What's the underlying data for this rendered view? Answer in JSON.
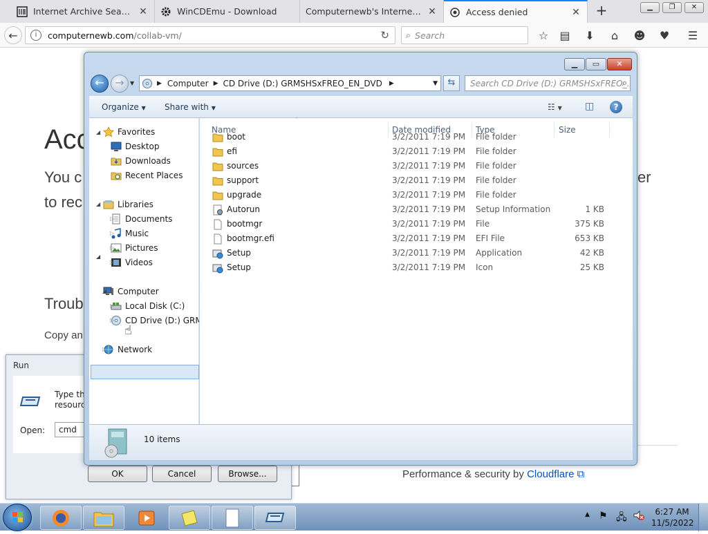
{
  "browser": {
    "tabs": [
      {
        "title": "Internet Archive Search: wi...",
        "icon": "archive-icon"
      },
      {
        "title": "WinCDEmu - Download",
        "icon": "gear-icon"
      },
      {
        "title": "Computernewb's Internet Pub ...",
        "icon": "none"
      },
      {
        "title": "Access denied",
        "icon": "cloudflare-icon"
      }
    ],
    "url_host": "computernewb.com",
    "url_path": "/collab-vm/",
    "search_placeholder": "Search"
  },
  "page": {
    "heading_partial": "Acc",
    "text_line1_partial": "You c",
    "text_line1_end": "er",
    "text_line2_partial": "to rec",
    "trouble_partial": "Troubl",
    "copy_partial": "Copy an",
    "footer_prefix": "Performance & security by",
    "footer_link": "Cloudflare"
  },
  "explorer": {
    "breadcrumb": [
      "Computer",
      "CD Drive (D:) GRMSHSxFREO_EN_DVD"
    ],
    "search_placeholder": "Search CD Drive (D:) GRMSHSxFREO_...",
    "toolbar": {
      "organize": "Organize",
      "share": "Share with"
    },
    "nav": {
      "favorites": "Favorites",
      "desktop": "Desktop",
      "downloads": "Downloads",
      "recent": "Recent Places",
      "libraries": "Libraries",
      "documents": "Documents",
      "music": "Music",
      "pictures": "Pictures",
      "videos": "Videos",
      "computer": "Computer",
      "local_disk": "Local Disk (C:)",
      "cd_drive": "CD Drive (D:) GRMSH",
      "network": "Network"
    },
    "columns": {
      "name": "Name",
      "date": "Date modified",
      "type": "Type",
      "size": "Size"
    },
    "files": [
      {
        "name": "boot",
        "date": "3/2/2011 7:19 PM",
        "type": "File folder",
        "size": "",
        "icon": "folder-icon"
      },
      {
        "name": "efi",
        "date": "3/2/2011 7:19 PM",
        "type": "File folder",
        "size": "",
        "icon": "folder-icon"
      },
      {
        "name": "sources",
        "date": "3/2/2011 7:19 PM",
        "type": "File folder",
        "size": "",
        "icon": "folder-icon"
      },
      {
        "name": "support",
        "date": "3/2/2011 7:19 PM",
        "type": "File folder",
        "size": "",
        "icon": "folder-icon"
      },
      {
        "name": "upgrade",
        "date": "3/2/2011 7:19 PM",
        "type": "File folder",
        "size": "",
        "icon": "folder-icon"
      },
      {
        "name": "Autorun",
        "date": "3/2/2011 7:19 PM",
        "type": "Setup Information",
        "size": "1 KB",
        "icon": "setup-info-icon"
      },
      {
        "name": "bootmgr",
        "date": "3/2/2011 7:19 PM",
        "type": "File",
        "size": "375 KB",
        "icon": "file-icon"
      },
      {
        "name": "bootmgr.efi",
        "date": "3/2/2011 7:19 PM",
        "type": "EFI File",
        "size": "653 KB",
        "icon": "file-icon"
      },
      {
        "name": "Setup",
        "date": "3/2/2011 7:19 PM",
        "type": "Application",
        "size": "42 KB",
        "icon": "setup-app-icon"
      },
      {
        "name": "Setup",
        "date": "3/2/2011 7:19 PM",
        "type": "Icon",
        "size": "25 KB",
        "icon": "setup-app-icon"
      }
    ],
    "status": "10 items"
  },
  "run": {
    "title": "Run",
    "desc_line1": "Type the",
    "desc_line2": "resource",
    "open_label": "Open:",
    "open_value": "cmd",
    "ok": "OK",
    "cancel": "Cancel",
    "browse": "Browse..."
  },
  "taskbar": {
    "time": "6:27 AM",
    "date": "11/5/2022"
  }
}
